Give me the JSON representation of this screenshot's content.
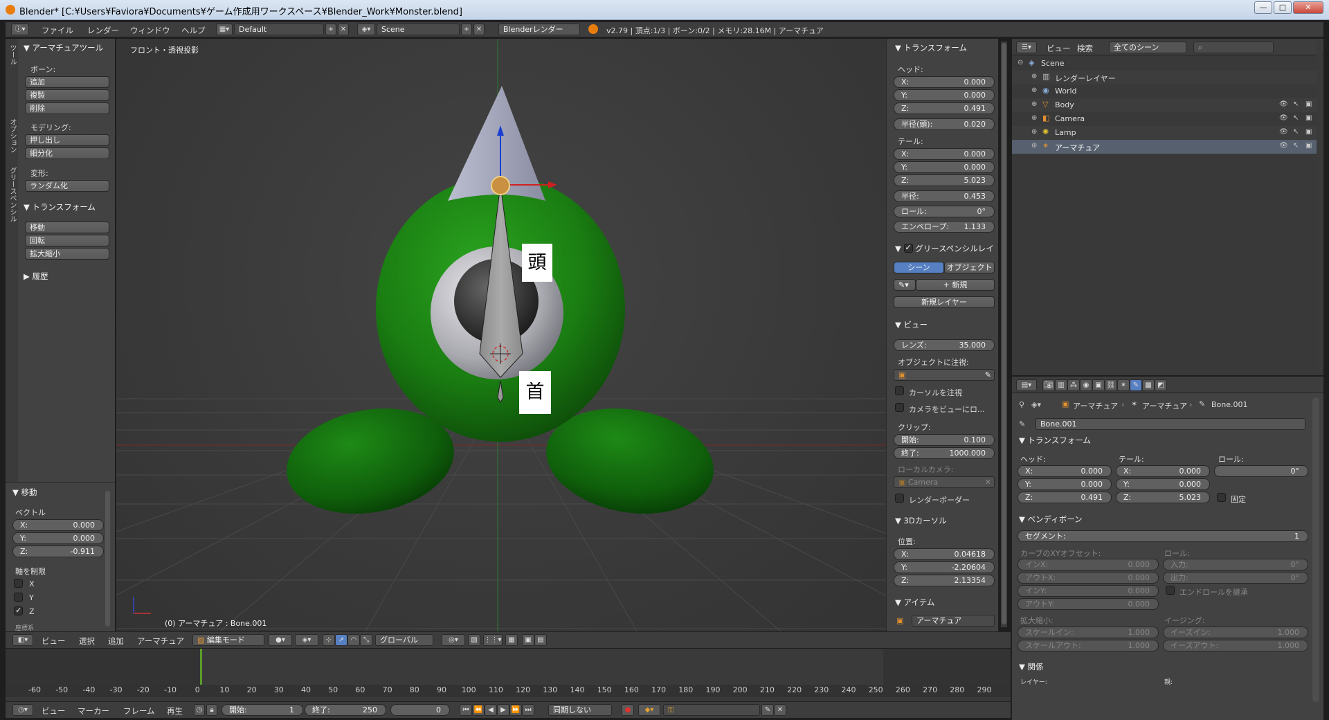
{
  "window": {
    "title": "Blender* [C:¥Users¥Faviora¥Documents¥ゲーム作成用ワークスペース¥Blender_Work¥Monster.blend]",
    "minimize": "—",
    "maximize": "□",
    "close": "✕"
  },
  "info_header": {
    "menus": [
      "ファイル",
      "レンダー",
      "ウィンドウ",
      "ヘルプ"
    ],
    "layout": "Default",
    "scene": "Scene",
    "engine": "Blenderレンダー",
    "stats": "v2.79 | 頂点:1/3 | ボーン:0/2 | メモリ:28.16M | アーマチュア"
  },
  "tool_shelf": {
    "tabs": [
      "ツール",
      "オプション",
      "グリースペンシル"
    ],
    "panel_title": "アーマチュアツール",
    "bone_label": "ボーン:",
    "bone_buttons": [
      "追加",
      "複製",
      "削除"
    ],
    "modeling_label": "モデリング:",
    "modeling_buttons": [
      "押し出し",
      "細分化"
    ],
    "deform_label": "変形:",
    "deform_buttons": [
      "ランダム化"
    ],
    "transform_title": "トランスフォーム",
    "transform_buttons": [
      "移動",
      "回転",
      "拡大縮小"
    ],
    "history_title": "履歴"
  },
  "operator_panel": {
    "title": "移動",
    "vector_label": "ベクトル",
    "x": "0.000",
    "y": "0.000",
    "z": "-0.911",
    "constraint_label": "軸を制限",
    "axes": [
      {
        "label": "X",
        "checked": false
      },
      {
        "label": "Y",
        "checked": false
      },
      {
        "label": "Z",
        "checked": true
      }
    ],
    "more": "座標系"
  },
  "viewport": {
    "view_name": "フロント・透視投影",
    "status": "(0) アーマチュア : Bone.001",
    "bone_labels": [
      "頭",
      "首"
    ],
    "header_menus": [
      "ビュー",
      "選択",
      "追加",
      "アーマチュア"
    ],
    "mode": "編集モード",
    "orientation": "グローバル"
  },
  "properties_n": {
    "transform_title": "トランスフォーム",
    "head_label": "ヘッド:",
    "head": [
      [
        "X:",
        "0.000"
      ],
      [
        "Y:",
        "0.000"
      ],
      [
        "Z:",
        "0.491"
      ]
    ],
    "radius_head": [
      "半径(頭):",
      "0.020"
    ],
    "tail_label": "テール:",
    "tail": [
      [
        "X:",
        "0.000"
      ],
      [
        "Y:",
        "0.000"
      ],
      [
        "Z:",
        "5.023"
      ]
    ],
    "radius": [
      "半径:",
      "0.453"
    ],
    "roll": [
      "ロール:",
      "0°"
    ],
    "envelope": [
      "エンベロープ:",
      "1.133"
    ],
    "gp_title": "グリースペンシルレイ",
    "gp_scene": "シーン",
    "gp_object": "オブジェクト",
    "gp_new": "新規",
    "gp_new_layer": "新規レイヤー",
    "view_title": "ビュー",
    "lens": [
      "レンズ:",
      "35.000"
    ],
    "lock_label": "オブジェクトに注視:",
    "lock_cursor": "カーソルを注視",
    "lock_camera": "カメラをビューにロ...",
    "clip_label": "クリップ:",
    "clip_start": [
      "開始:",
      "0.100"
    ],
    "clip_end": [
      "終了:",
      "1000.000"
    ],
    "local_camera_label": "ローカルカメラ:",
    "local_camera": "Camera",
    "render_border": "レンダーボーダー",
    "cursor_title": "3Dカーソル",
    "location_label": "位置:",
    "cursor": [
      [
        "X:",
        "0.04618"
      ],
      [
        "Y:",
        "-2.20604"
      ],
      [
        "Z:",
        "2.13354"
      ]
    ],
    "item_title": "アイテム",
    "item_name": "アーマチュア"
  },
  "outliner": {
    "view": "ビュー",
    "search": "検索",
    "display": "全てのシーン",
    "items": [
      {
        "name": "Scene",
        "indent": 0,
        "visible_icons": false,
        "selected": false
      },
      {
        "name": "レンダーレイヤー",
        "indent": 1,
        "visible_icons": false,
        "selected": false
      },
      {
        "name": "World",
        "indent": 1,
        "visible_icons": false,
        "selected": false
      },
      {
        "name": "Body",
        "indent": 1,
        "visible_icons": true,
        "selected": false
      },
      {
        "name": "Camera",
        "indent": 1,
        "visible_icons": true,
        "selected": false
      },
      {
        "name": "Lamp",
        "indent": 1,
        "visible_icons": true,
        "selected": false
      },
      {
        "name": "アーマチュア",
        "indent": 1,
        "visible_icons": true,
        "selected": true
      }
    ]
  },
  "bone_properties": {
    "breadcrumb": [
      "アーマチュア",
      "アーマチュア",
      "Bone.001"
    ],
    "bone_name": "Bone.001",
    "transform_title": "トランスフォーム",
    "head_label": "ヘッド:",
    "tail_label": "テール:",
    "roll_label": "ロール:",
    "head": [
      [
        "X:",
        "0.000"
      ],
      [
        "Y:",
        "0.000"
      ],
      [
        "Z:",
        "0.491"
      ]
    ],
    "tail": [
      [
        "X:",
        "0.000"
      ],
      [
        "Y:",
        "0.000"
      ],
      [
        "Z:",
        "5.023"
      ]
    ],
    "roll": "0°",
    "lock": "固定",
    "bendy_title": "ベンディボーン",
    "segments": [
      "セグメント:",
      "1"
    ],
    "curve_label": "カーブのXYオフセット:",
    "roll2_label": "ロール:",
    "curve": [
      [
        "インX:",
        "0.000"
      ],
      [
        "アウトX:",
        "0.000"
      ],
      [
        "インY:",
        "0.000"
      ],
      [
        "アウトY:",
        "0.000"
      ]
    ],
    "roll_in": [
      "入力:",
      "0°"
    ],
    "roll_out": [
      "出力:",
      "0°"
    ],
    "inherit_roll": "エンドロールを継承",
    "scale_label": "拡大縮小:",
    "easing_label": "イージング:",
    "scale_in": [
      "スケールイン:",
      "1.000"
    ],
    "scale_out": [
      "スケールアウト:",
      "1.000"
    ],
    "ease_in": [
      "イーズイン:",
      "1.000"
    ],
    "ease_out": [
      "イーズアウト:",
      "1.000"
    ],
    "relations_title": "関係",
    "layers_label": "レイヤー:",
    "parent_label": "親:"
  },
  "timeline": {
    "ticks": [
      -60,
      -50,
      -40,
      -30,
      -20,
      -10,
      0,
      10,
      20,
      30,
      40,
      50,
      60,
      70,
      80,
      90,
      100,
      110,
      120,
      130,
      140,
      150,
      160,
      170,
      180,
      190,
      200,
      210,
      220,
      230,
      240,
      250,
      260,
      270,
      280,
      290
    ],
    "current_frame": 0,
    "menus": [
      "ビュー",
      "マーカー",
      "フレーム",
      "再生"
    ],
    "start": [
      "開始:",
      "1"
    ],
    "end": [
      "終了:",
      "250"
    ],
    "frame": "0",
    "sync": "同期しない"
  },
  "colors": {
    "accent": "#5680c2",
    "body_green": "#1d8a12",
    "selected_row": "#56606e"
  }
}
